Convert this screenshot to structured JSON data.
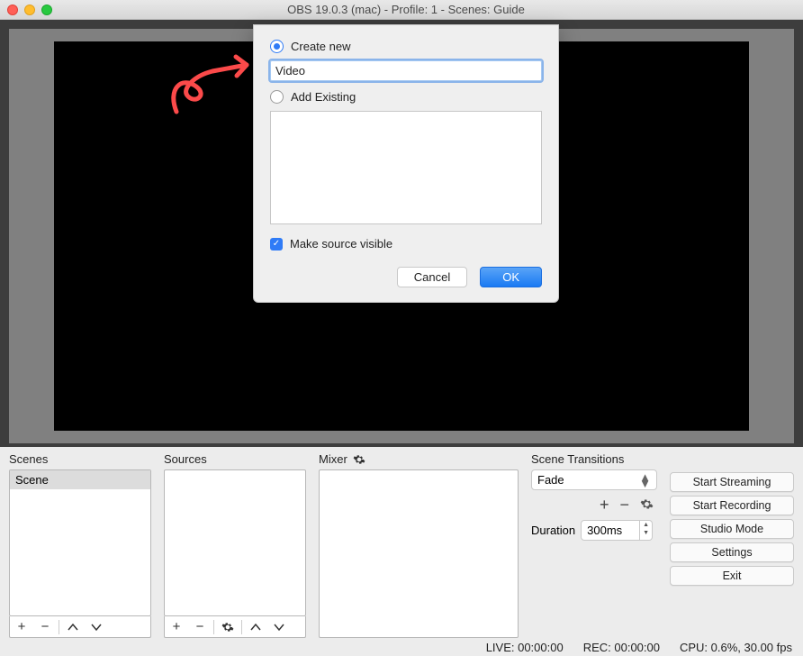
{
  "window": {
    "title": "OBS 19.0.3 (mac) - Profile: 1 - Scenes: Guide"
  },
  "dialog": {
    "create_new_label": "Create new",
    "name_value": "Video",
    "add_existing_label": "Add Existing",
    "visible_label": "Make source visible",
    "cancel": "Cancel",
    "ok": "OK"
  },
  "panels": {
    "scenes_title": "Scenes",
    "sources_title": "Sources",
    "mixer_title": "Mixer",
    "transitions_title": "Scene Transitions"
  },
  "scenes": {
    "items": [
      "Scene"
    ]
  },
  "transitions": {
    "selected": "Fade",
    "duration_label": "Duration",
    "duration_value": "300ms"
  },
  "right_buttons": {
    "start_streaming": "Start Streaming",
    "start_recording": "Start Recording",
    "studio_mode": "Studio Mode",
    "settings": "Settings",
    "exit": "Exit"
  },
  "status": {
    "live": "LIVE: 00:00:00",
    "rec": "REC: 00:00:00",
    "cpu": "CPU: 0.6%, 30.00 fps"
  }
}
